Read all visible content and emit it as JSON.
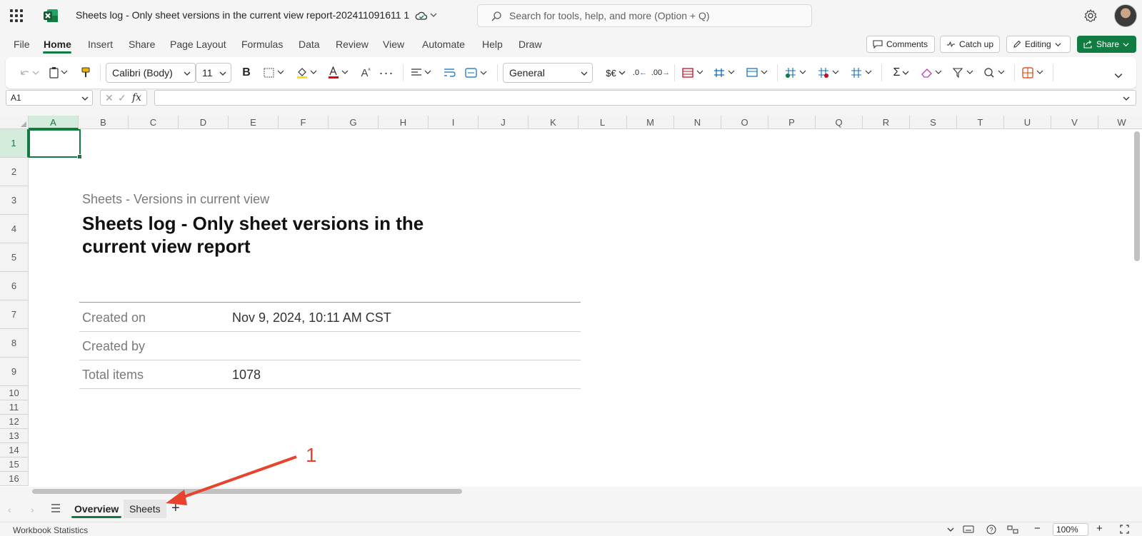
{
  "app": {
    "document_title": "Sheets log - Only sheet versions in the current view report-202411091611 1",
    "search_placeholder": "Search for tools, help, and more (Option + Q)"
  },
  "menu": {
    "tabs": [
      "File",
      "Home",
      "Insert",
      "Share",
      "Page Layout",
      "Formulas",
      "Data",
      "Review",
      "View",
      "Automate",
      "Help",
      "Draw"
    ],
    "active_tab": "Home",
    "comments_label": "Comments",
    "catchup_label": "Catch up",
    "editing_label": "Editing",
    "share_label": "Share"
  },
  "ribbon": {
    "font_name": "Calibri (Body)",
    "font_size": "11",
    "number_format": "General"
  },
  "formula_bar": {
    "name_box": "A1",
    "formula": ""
  },
  "grid": {
    "columns": [
      "A",
      "B",
      "C",
      "D",
      "E",
      "F",
      "G",
      "H",
      "I",
      "J",
      "K",
      "L",
      "M",
      "N",
      "O",
      "P",
      "Q",
      "R",
      "S",
      "T",
      "U",
      "V",
      "W"
    ],
    "rows": [
      "1",
      "2",
      "3",
      "4",
      "5",
      "6",
      "7",
      "8",
      "9",
      "10",
      "11",
      "12",
      "13",
      "14",
      "15",
      "16"
    ],
    "selected_column": "A",
    "selected_row": "1"
  },
  "report": {
    "subtitle": "Sheets - Versions in current view",
    "title": "Sheets log - Only sheet versions in the current view report",
    "meta": [
      {
        "label": "Created on",
        "value": "Nov 9, 2024, 10:11 AM CST"
      },
      {
        "label": "Created by",
        "value": ""
      },
      {
        "label": "Total items",
        "value": "1078"
      }
    ]
  },
  "sheet_tabs": [
    {
      "label": "Overview",
      "active": true
    },
    {
      "label": "Sheets",
      "active": false
    }
  ],
  "status": {
    "left_text": "Workbook Statistics",
    "zoom": "100%"
  },
  "annotation": {
    "label": "1",
    "color": "#e8432d"
  },
  "colors": {
    "accent": "#107c41"
  }
}
